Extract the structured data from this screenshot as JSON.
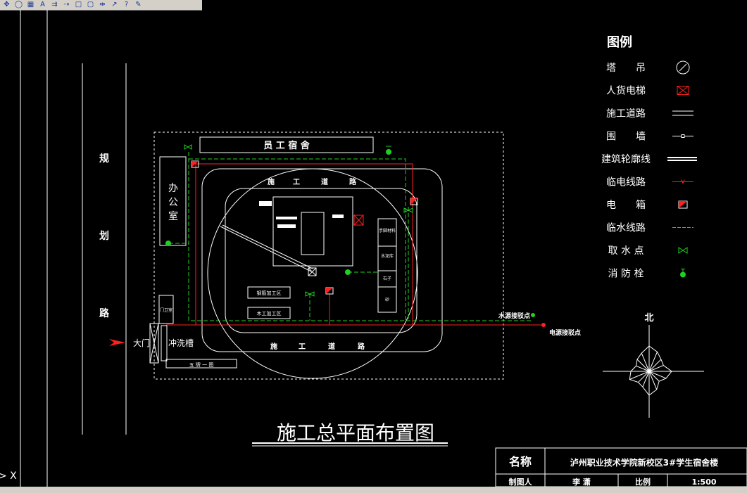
{
  "toolbar": {
    "icons": [
      "pan-icon",
      "orbit-icon",
      "grid-icon",
      "text-style-icon",
      "arrow-icon",
      "arrow2-icon",
      "square-icon",
      "square2-icon",
      "align-icon",
      "arrow3-icon",
      "question-icon",
      "paint-icon"
    ]
  },
  "drawing": {
    "title": "施工总平面布置图",
    "road_left_label": [
      "规",
      "划",
      "路"
    ],
    "dormitory_label": "员 工 宿 舍",
    "office_label": [
      "办",
      "公",
      "室"
    ],
    "gatehouse_label": "门卫室",
    "road_top_label": [
      "施",
      "工",
      "道",
      "路"
    ],
    "road_bottom_label": [
      "施",
      "工",
      "道",
      "路"
    ],
    "steel_shop": "钢筋加工区",
    "wood_shop": "木工加工区",
    "material_a": "手脚材料",
    "material_b": "水泥库",
    "material_c": "石子",
    "material_d": "砂",
    "gate_label": "大门",
    "wash_label": "冲洗槽",
    "wuzhi_label": "五 牌 一 图",
    "water_point_label": "水源接驳点",
    "power_point_label": "电源接驳点",
    "north_label": "北"
  },
  "legend": {
    "title": "图例",
    "items": [
      {
        "label": "塔　　吊",
        "icon": "tower-crane-icon"
      },
      {
        "label": "人货电梯",
        "icon": "elevator-icon"
      },
      {
        "label": "施工道路",
        "icon": "road-icon"
      },
      {
        "label": "围　　墙",
        "icon": "wall-icon"
      },
      {
        "label": "建筑轮廓线",
        "icon": "outline-icon"
      },
      {
        "label": "临电线路",
        "icon": "power-line-icon"
      },
      {
        "label": "电　　箱",
        "icon": "power-box-icon"
      },
      {
        "label": "临水线路",
        "icon": "water-line-icon"
      },
      {
        "label": "取 水 点",
        "icon": "water-point-icon"
      },
      {
        "label": "消 防 栓",
        "icon": "hydrant-icon"
      }
    ]
  },
  "title_block": {
    "name_label": "名称",
    "name_value": "泸州职业技术学院新校区3#学生宿舍楼",
    "drawer_label": "制图人",
    "drawer_value": "李 潇",
    "scale_label": "比例",
    "scale_value": "1:500"
  },
  "colors": {
    "power": "#ff2020",
    "water": "#20d020",
    "line": "#ffffff"
  }
}
